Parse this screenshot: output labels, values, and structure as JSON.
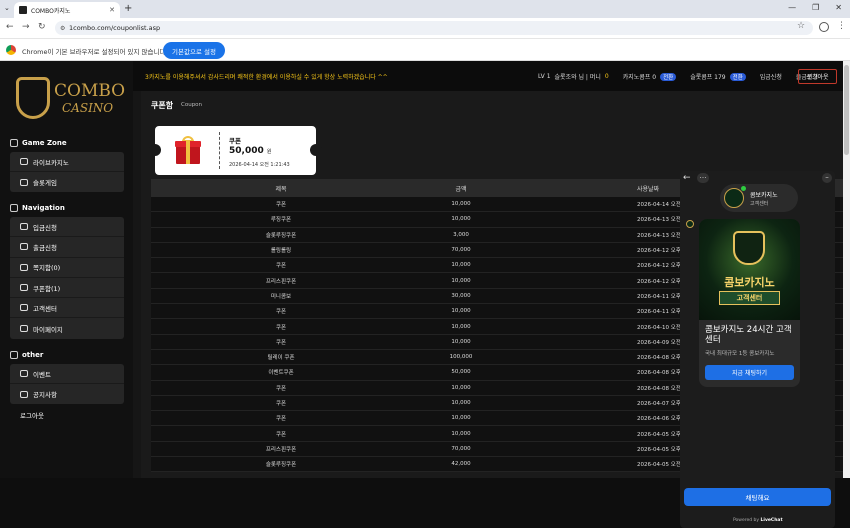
{
  "browser": {
    "tab_title": "COMBO카지노",
    "url": "1combo.com/couponlist.asp",
    "infobar_message": "Chrome이 기본 브라우저로 설정되어 있지 않습니다.",
    "infobar_button": "기본값으로 설정"
  },
  "logo": {
    "line1": "COMBO",
    "line2": "CASINO"
  },
  "sidebar": {
    "game_zone": "Game Zone",
    "game_items": [
      {
        "label": "라이브카지노"
      },
      {
        "label": "슬롯게임"
      }
    ],
    "navigation": "Navigation",
    "nav_items": [
      {
        "label": "입금신청"
      },
      {
        "label": "출금신청"
      },
      {
        "label": "쪽지함(0)"
      },
      {
        "label": "쿠폰함(1)"
      },
      {
        "label": "고객센터"
      },
      {
        "label": "마이페이지"
      }
    ],
    "other": "other",
    "other_items": [
      {
        "label": "이벤트"
      },
      {
        "label": "공지사항"
      }
    ],
    "logout": "로그아웃"
  },
  "topbar": {
    "notice": "3카지노를 이용해주셔서 감사드리며 쾌적한 환경에서 이용하실 수 있게 항상 노력하겠습니다 ^^",
    "level": "LV 1",
    "user": "슬롯조와 님 | 머니",
    "money": "0",
    "casino_label": "카지노콤프 0",
    "casino_pill": "전환",
    "slot_label": "슬롯콤프 179",
    "slot_pill": "전환",
    "deposit": "입금신청",
    "withdraw": "출금신청",
    "logout_button": "로그아웃"
  },
  "page": {
    "title": "쿠폰함",
    "subtitle": "Coupon"
  },
  "coupon": {
    "name": "쿠폰",
    "amount": "50,000",
    "unit": "원",
    "date": "2026-04-14 오전 1:21:43"
  },
  "table": {
    "headers": [
      "제목",
      "금액",
      "사용날짜"
    ],
    "rows": [
      {
        "title": "쿠폰",
        "amount": "10,000",
        "date": "2026-04-14 오전"
      },
      {
        "title": "루징쿠폰",
        "amount": "10,000",
        "date": "2026-04-13 오전"
      },
      {
        "title": "슬롯루징쿠폰",
        "amount": "3,000",
        "date": "2026-04-13 오전"
      },
      {
        "title": "롤링롤링",
        "amount": "70,000",
        "date": "2026-04-12 오후"
      },
      {
        "title": "쿠폰",
        "amount": "10,000",
        "date": "2026-04-12 오후"
      },
      {
        "title": "프리스핀쿠폰",
        "amount": "10,000",
        "date": "2026-04-12 오후"
      },
      {
        "title": "미니콤보",
        "amount": "30,000",
        "date": "2026-04-11 오후"
      },
      {
        "title": "쿠폰",
        "amount": "10,000",
        "date": "2026-04-11 오후"
      },
      {
        "title": "쿠폰",
        "amount": "10,000",
        "date": "2026-04-10 오전"
      },
      {
        "title": "쿠폰",
        "amount": "10,000",
        "date": "2026-04-09 오전"
      },
      {
        "title": "릴레이 쿠폰",
        "amount": "100,000",
        "date": "2026-04-08 오후"
      },
      {
        "title": "이벤트쿠폰",
        "amount": "50,000",
        "date": "2026-04-08 오후"
      },
      {
        "title": "쿠폰",
        "amount": "10,000",
        "date": "2026-04-08 오전"
      },
      {
        "title": "쿠폰",
        "amount": "10,000",
        "date": "2026-04-07 오후"
      },
      {
        "title": "쿠폰",
        "amount": "10,000",
        "date": "2026-04-06 오후"
      },
      {
        "title": "쿠폰",
        "amount": "10,000",
        "date": "2026-04-05 오후"
      },
      {
        "title": "프리스핀쿠폰",
        "amount": "70,000",
        "date": "2026-04-05 오후"
      },
      {
        "title": "슬롯루징쿠폰",
        "amount": "42,000",
        "date": "2026-04-05 오전 12:31:07"
      }
    ]
  },
  "chat": {
    "name": "콤보카지노",
    "status": "고객센터",
    "card_image_title": "콤보카지노",
    "card_image_sub": "고객센터",
    "card_title": "콤보카지노 24시간 고객센터",
    "card_sub": "국내 최대규모 1등 콤보카지노",
    "card_button": "지금 채팅하기",
    "send_button": "채팅해요",
    "powered": "Powered by",
    "brand": "LiveChat"
  }
}
